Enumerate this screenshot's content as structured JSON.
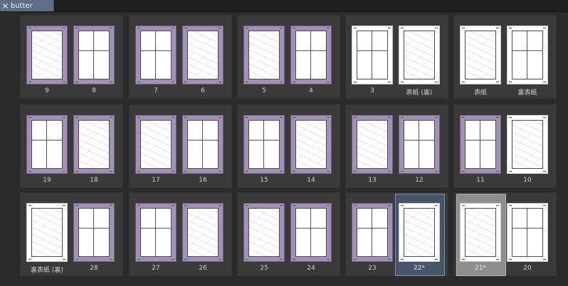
{
  "tab": {
    "title": "butter",
    "close_icon": "close-icon"
  },
  "rows": [
    [
      {
        "pages": [
          {
            "label": "9",
            "style": "purple"
          },
          {
            "label": "8",
            "style": "purple"
          }
        ]
      },
      {
        "pages": [
          {
            "label": "7",
            "style": "purple"
          },
          {
            "label": "6",
            "style": "purple"
          }
        ]
      },
      {
        "pages": [
          {
            "label": "5",
            "style": "purple"
          },
          {
            "label": "4",
            "style": "purple"
          }
        ]
      },
      {
        "pages": [
          {
            "label": "3",
            "style": "white"
          },
          {
            "label": "表紙 (裏)",
            "style": "white"
          }
        ]
      },
      {
        "pages": [
          {
            "label": "表紙",
            "style": "white"
          },
          {
            "label": "裏表紙",
            "style": "white"
          }
        ]
      }
    ],
    [
      {
        "pages": [
          {
            "label": "19",
            "style": "purple"
          },
          {
            "label": "18",
            "style": "purple"
          }
        ]
      },
      {
        "pages": [
          {
            "label": "17",
            "style": "purple"
          },
          {
            "label": "16",
            "style": "purple"
          }
        ]
      },
      {
        "pages": [
          {
            "label": "15",
            "style": "purple"
          },
          {
            "label": "14",
            "style": "purple"
          }
        ]
      },
      {
        "pages": [
          {
            "label": "13",
            "style": "purple"
          },
          {
            "label": "12",
            "style": "purple"
          }
        ]
      },
      {
        "pages": [
          {
            "label": "11",
            "style": "purple"
          },
          {
            "label": "10",
            "style": "white"
          }
        ]
      }
    ],
    [
      {
        "pages": [
          {
            "label": "裏表紙 (裏)",
            "style": "white"
          },
          {
            "label": "28",
            "style": "purple"
          }
        ]
      },
      {
        "pages": [
          {
            "label": "27",
            "style": "purple"
          },
          {
            "label": "26",
            "style": "purple"
          }
        ]
      },
      {
        "pages": [
          {
            "label": "25",
            "style": "purple"
          },
          {
            "label": "24",
            "style": "purple"
          }
        ]
      },
      {
        "pages": [
          {
            "label": "23",
            "style": "purple"
          },
          {
            "label": "22*",
            "style": "white",
            "selected": "blue"
          }
        ]
      },
      {
        "pages": [
          {
            "label": "21*",
            "style": "white",
            "selected": "grey"
          },
          {
            "label": "20",
            "style": "white"
          }
        ]
      }
    ]
  ]
}
